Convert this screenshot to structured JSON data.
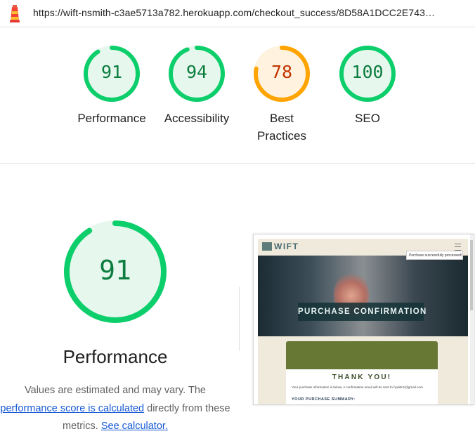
{
  "topbar": {
    "url": "https://wift-nsmith-c3ae5713a782.herokuapp.com/checkout_success/8D58A1DCC2E743…"
  },
  "scores": [
    {
      "label": "Performance",
      "value": "91",
      "score": 0.91,
      "status": "pass"
    },
    {
      "label": "Accessibility",
      "value": "94",
      "score": 0.94,
      "status": "pass"
    },
    {
      "label": "Best Practices",
      "value": "78",
      "score": 0.78,
      "status": "average"
    },
    {
      "label": "SEO",
      "value": "100",
      "score": 1.0,
      "status": "pass"
    }
  ],
  "colors": {
    "pass_stroke": "#0cce6b",
    "pass_fill": "#e6f8ed",
    "pass_text": "#0c7c3f",
    "average_stroke": "#ffa400",
    "average_fill": "#fff3e0",
    "average_text": "#c33300",
    "link": "#1558d6"
  },
  "performance": {
    "value": "91",
    "score": 0.91,
    "title": "Performance",
    "desc_line1": "Values are estimated and may vary. The",
    "link_score": "performance score is calculated",
    "desc_line2_rest": " directly from these",
    "desc_line3_pre": "metrics. ",
    "link_calculator": "See calculator."
  },
  "thumbnail": {
    "logo": "WIFT",
    "toast": "Purchase successfully processed!",
    "hero_title": "PURCHASE CONFIRMATION",
    "thanks": "THANK YOU!",
    "info": "Your purchase information is below. A confirmation email will be sent to hyaldn1@gmail.com",
    "summary": "YOUR PURCHASE SUMMARY:"
  },
  "icons": {
    "lighthouse": "lighthouse-icon",
    "menu": "hamburger-menu-icon"
  }
}
